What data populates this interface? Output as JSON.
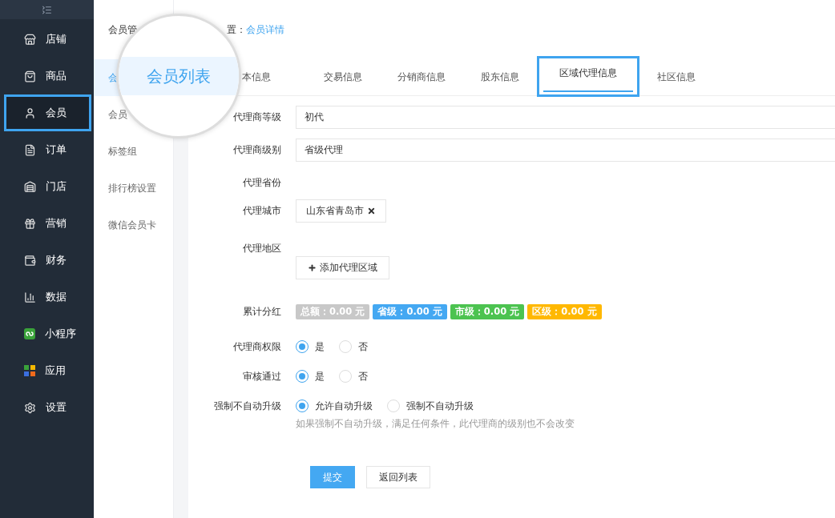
{
  "sidebar": {
    "items": [
      {
        "label": "店铺",
        "selected": false,
        "highlighted": false
      },
      {
        "label": "商品",
        "selected": false,
        "highlighted": false
      },
      {
        "label": "会员",
        "selected": true,
        "highlighted": true
      },
      {
        "label": "订单",
        "selected": false,
        "highlighted": false
      },
      {
        "label": "门店",
        "selected": false,
        "highlighted": false
      },
      {
        "label": "营销",
        "selected": false,
        "highlighted": false
      },
      {
        "label": "财务",
        "selected": false,
        "highlighted": false
      },
      {
        "label": "数据",
        "selected": false,
        "highlighted": false
      },
      {
        "label": "小程序",
        "selected": false,
        "highlighted": false
      },
      {
        "label": "应用",
        "selected": false,
        "highlighted": false
      },
      {
        "label": "设置",
        "selected": false,
        "highlighted": false
      }
    ]
  },
  "subnav": {
    "title": "会员管",
    "items": [
      {
        "label": "会",
        "selected": true
      },
      {
        "label": "会员",
        "selected": false
      },
      {
        "label": "标签组",
        "selected": false
      },
      {
        "label": "排行榜设置",
        "selected": false
      },
      {
        "label": "微信会员卡",
        "selected": false
      }
    ]
  },
  "magnifier": {
    "text": "会员列表"
  },
  "breadcrumb": {
    "prefix": "置：",
    "current": "会员详情"
  },
  "tabs": [
    {
      "label": "本信息",
      "selected": false,
      "highlighted": false
    },
    {
      "label": "交易信息",
      "selected": false,
      "highlighted": false
    },
    {
      "label": "分销商信息",
      "selected": false,
      "highlighted": false
    },
    {
      "label": "股东信息",
      "selected": false,
      "highlighted": false
    },
    {
      "label": "区域代理信息",
      "selected": true,
      "highlighted": true
    },
    {
      "label": "社区信息",
      "selected": false,
      "highlighted": false
    }
  ],
  "form": [
    {
      "kind": "input",
      "label": "代理商等级",
      "value": "初代"
    },
    {
      "kind": "input",
      "label": "代理商级别",
      "value": "省级代理"
    },
    {
      "kind": "empty",
      "label": "代理省份"
    },
    {
      "kind": "tags",
      "label": "代理城市",
      "tags": [
        "山东省青岛市"
      ]
    },
    {
      "kind": "add",
      "label": "代理地区",
      "button": "添加代理区域"
    },
    {
      "kind": "badges",
      "label": "累计分红",
      "badges": [
        {
          "text": "总额：0.00 元",
          "color": "#c8c8c8"
        },
        {
          "text": "省级：0.00 元",
          "color": "#44a8f2"
        },
        {
          "text": "市级：0.00 元",
          "color": "#4cc350"
        },
        {
          "text": "区级：0.00 元",
          "color": "#ffb800"
        }
      ]
    },
    {
      "kind": "radio",
      "label": "代理商权限",
      "options": [
        {
          "label": "是",
          "selected": true
        },
        {
          "label": "否",
          "selected": false
        }
      ]
    },
    {
      "kind": "radio",
      "label": "审核通过",
      "options": [
        {
          "label": "是",
          "selected": true
        },
        {
          "label": "否",
          "selected": false
        }
      ]
    },
    {
      "kind": "radio",
      "label": "强制不自动升级",
      "options": [
        {
          "label": "允许自动升级",
          "selected": true
        },
        {
          "label": "强制不自动升级",
          "selected": false
        }
      ],
      "hint": "如果强制不自动升级，满足任何条件，此代理商的级别也不会改变"
    }
  ],
  "actions": {
    "submit": "提交",
    "back": "返回列表"
  }
}
